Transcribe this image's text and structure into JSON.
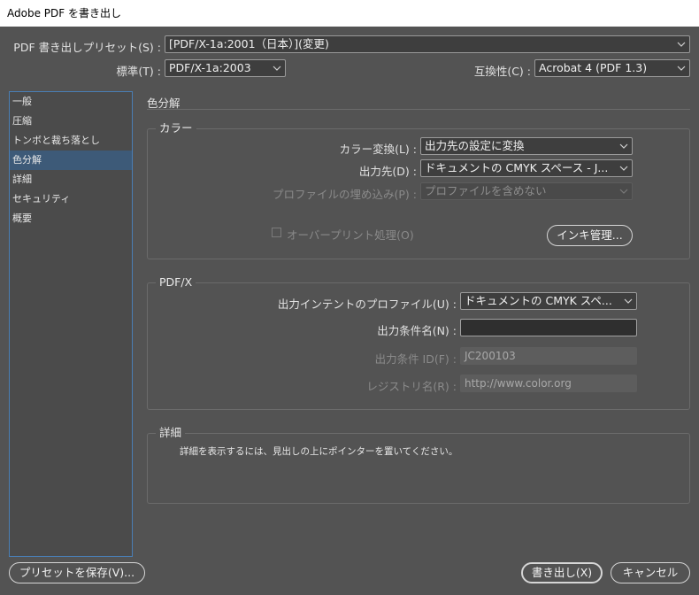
{
  "window": {
    "title": "Adobe PDF を書き出し"
  },
  "preset": {
    "label": "PDF 書き出しプリセット(S) :",
    "value": "[PDF/X-1a:2001（日本）](変更)"
  },
  "standard": {
    "label": "標準(T) :",
    "value": "PDF/X-1a:2003"
  },
  "compat": {
    "label": "互換性(C) :",
    "value": "Acrobat 4 (PDF 1.3)"
  },
  "sidebar": {
    "items": [
      {
        "label": "一般"
      },
      {
        "label": "圧縮"
      },
      {
        "label": "トンボと裁ち落とし"
      },
      {
        "label": "色分解"
      },
      {
        "label": "詳細"
      },
      {
        "label": "セキュリティ"
      },
      {
        "label": "概要"
      }
    ],
    "active_index": 3
  },
  "section": {
    "title": "色分解"
  },
  "color": {
    "title": "カラー",
    "conversion": {
      "label": "カラー変換(L) :",
      "value": "出力先の設定に変換"
    },
    "destination": {
      "label": "出力先(D) :",
      "value": "ドキュメントの CMYK スペース - J..."
    },
    "profile_embed": {
      "label": "プロファイルの埋め込み(P) :",
      "value": "プロファイルを含めない"
    },
    "overprint": {
      "label": "オーバープリント処理(O)",
      "checked": false
    },
    "ink_manager": "インキ管理..."
  },
  "pdfx": {
    "title": "PDF/X",
    "output_intent": {
      "label": "出力インテントのプロファイル(U) :",
      "value": "ドキュメントの CMYK スペ..."
    },
    "condition_name": {
      "label": "出力条件名(N) :",
      "value": ""
    },
    "condition_id": {
      "label": "出力条件 ID(F) :",
      "value": "JC200103"
    },
    "registry": {
      "label": "レジストリ名(R) :",
      "value": "http://www.color.org"
    }
  },
  "details": {
    "title": "詳細",
    "text": "詳細を表示するには、見出しの上にポインターを置いてください。"
  },
  "buttons": {
    "save_preset": "プリセットを保存(V)...",
    "export": "書き出し(X)",
    "cancel": "キャンセル"
  },
  "colors": {
    "background": "#535353",
    "selection": "#3d5a78",
    "sidebar_border": "#4a7eb4"
  }
}
